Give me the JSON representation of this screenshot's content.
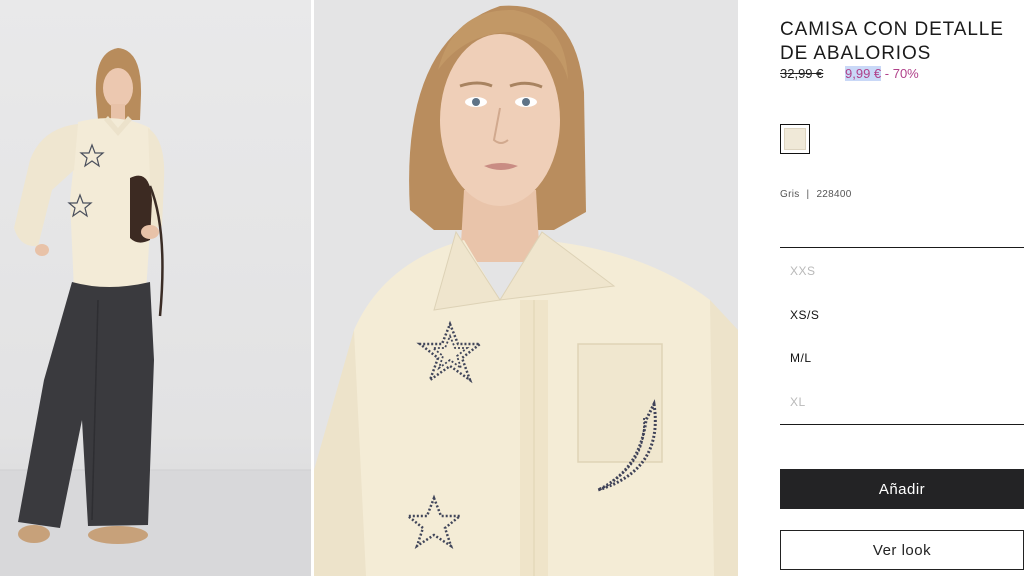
{
  "product": {
    "title": "CAMISA CON DETALLE DE ABALORIOS",
    "old_price": "32,99 €",
    "new_price": "9,99 €",
    "discount": "- 70%",
    "swatch_color": "#f0e9d8",
    "color_name": "Gris",
    "separator": "|",
    "reference": "228400"
  },
  "sizes": [
    {
      "label": "XXS",
      "available": false
    },
    {
      "label": "XS/S",
      "available": true
    },
    {
      "label": "M/L",
      "available": true
    },
    {
      "label": "XL",
      "available": false
    }
  ],
  "actions": {
    "add_label": "Añadir",
    "look_label": "Ver look"
  },
  "colors": {
    "accent_price": "#b0418a",
    "button_dark": "#232325"
  }
}
